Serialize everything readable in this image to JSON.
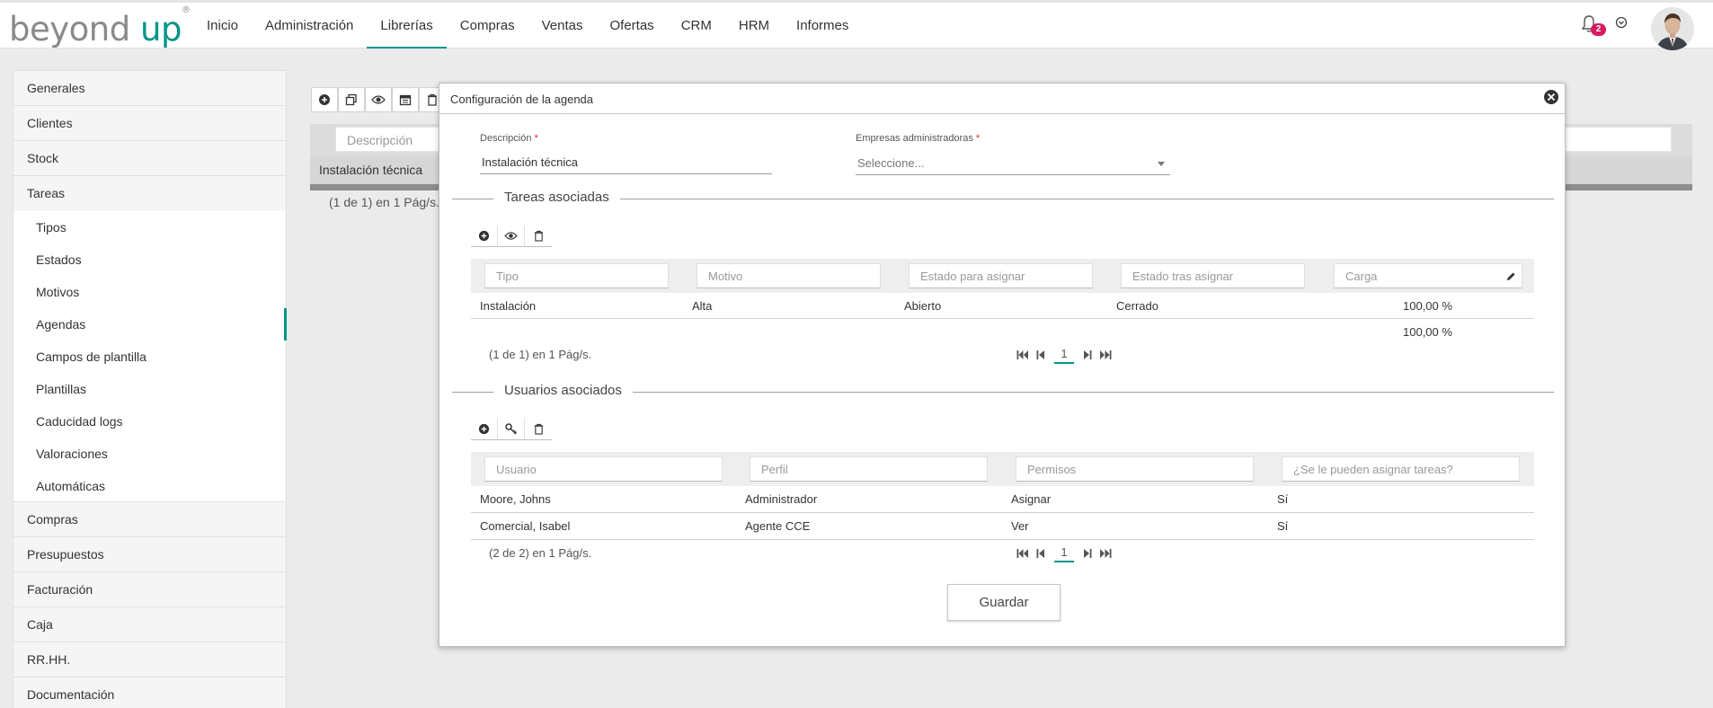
{
  "header": {
    "logo_main": "beyond",
    "logo_accent": "up",
    "logo_mark": "®",
    "nav": [
      {
        "label": "Inicio"
      },
      {
        "label": "Administración"
      },
      {
        "label": "Librerías"
      },
      {
        "label": "Compras"
      },
      {
        "label": "Ventas"
      },
      {
        "label": "Ofertas"
      },
      {
        "label": "CRM"
      },
      {
        "label": "HRM"
      },
      {
        "label": "Informes"
      }
    ],
    "active_nav": "Librerías",
    "notification_count": "2",
    "icons": [
      "bell-icon",
      "chevron-circle-icon",
      "user-avatar"
    ]
  },
  "sidebar": {
    "top_items": [
      {
        "label": "Generales"
      },
      {
        "label": "Clientes"
      },
      {
        "label": "Stock"
      },
      {
        "label": "Tareas"
      }
    ],
    "sub_items": [
      {
        "label": "Tipos"
      },
      {
        "label": "Estados"
      },
      {
        "label": "Motivos"
      },
      {
        "label": "Agendas"
      },
      {
        "label": "Campos de plantilla"
      },
      {
        "label": "Plantillas"
      },
      {
        "label": "Caducidad logs"
      },
      {
        "label": "Valoraciones"
      },
      {
        "label": "Automáticas"
      }
    ],
    "active_sub": "Agendas",
    "bottom_items": [
      {
        "label": "Compras"
      },
      {
        "label": "Presupuestos"
      },
      {
        "label": "Facturación"
      },
      {
        "label": "Caja"
      },
      {
        "label": "RR.HH."
      },
      {
        "label": "Documentación"
      }
    ]
  },
  "background": {
    "toolbar_icons": [
      "add-icon",
      "copy-icon",
      "view-icon",
      "calendar-icon",
      "delete-icon"
    ],
    "filter_placeholder": "Descripción",
    "row_text": "Instalación técnica",
    "pager_text": "(1 de 1) en 1 Pág/s."
  },
  "dialog": {
    "title": "Configuración de la agenda",
    "description_label": "Descripción",
    "description_value": "Instalación técnica",
    "companies_label": "Empresas administradoras",
    "required_mark": "*",
    "companies_placeholder": "Seleccione...",
    "tasks": {
      "legend": "Tareas asociadas",
      "toolbar_icons": [
        "add-icon",
        "view-icon",
        "delete-icon"
      ],
      "filters": [
        "Tipo",
        "Motivo",
        "Estado para asignar",
        "Estado tras asignar",
        "Carga"
      ],
      "rows": [
        {
          "tipo": "Instalación",
          "motivo": "Alta",
          "estado_asignar": "Abierto",
          "estado_tras": "Cerrado",
          "carga": "100,00 %"
        }
      ],
      "total": "100,00 %",
      "pager_text": "(1 de 1) en 1 Pág/s.",
      "page": "1"
    },
    "users": {
      "legend": "Usuarios asociados",
      "toolbar_icons": [
        "add-icon",
        "key-icon",
        "delete-icon"
      ],
      "filters": [
        "Usuario",
        "Perfil",
        "Permisos",
        "¿Se le pueden asignar tareas?"
      ],
      "rows": [
        {
          "usuario": "Moore, Johns",
          "perfil": "Administrador",
          "permisos": "Asignar",
          "asignar": "Sí"
        },
        {
          "usuario": "Comercial, Isabel",
          "perfil": "Agente CCE",
          "permisos": "Ver",
          "asignar": "Sí"
        }
      ],
      "pager_text": "(2 de 2) en 1 Pág/s.",
      "page": "1"
    },
    "save_label": "Guardar"
  },
  "colors": {
    "accent": "#009688",
    "badge": "#d81b60",
    "required": "#d32f2f"
  }
}
